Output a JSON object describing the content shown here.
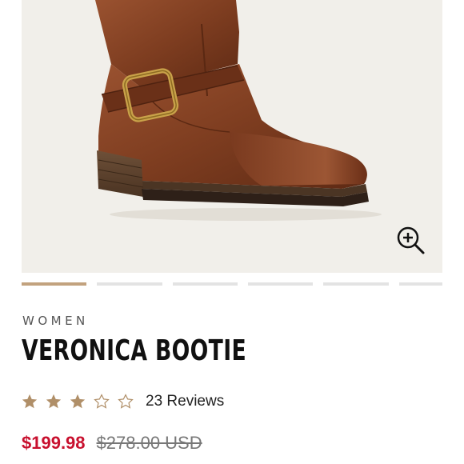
{
  "product": {
    "category": "WOMEN",
    "name": "VERONICA BOOTIE",
    "rating": 3,
    "rating_max": 5,
    "reviews_label": "23 Reviews",
    "sale_price": "$199.98",
    "original_price": "$278.00 USD"
  },
  "gallery": {
    "image_count": 6,
    "active_index": 0,
    "zoom_icon": "zoom-in-icon"
  },
  "colors": {
    "hero_background": "#f1efea",
    "active_indicator": "#c2a27e",
    "inactive_indicator": "#e3e3e3",
    "sale_price": "#c8102e",
    "star": "#b08f68",
    "leather": "#8a4526"
  }
}
